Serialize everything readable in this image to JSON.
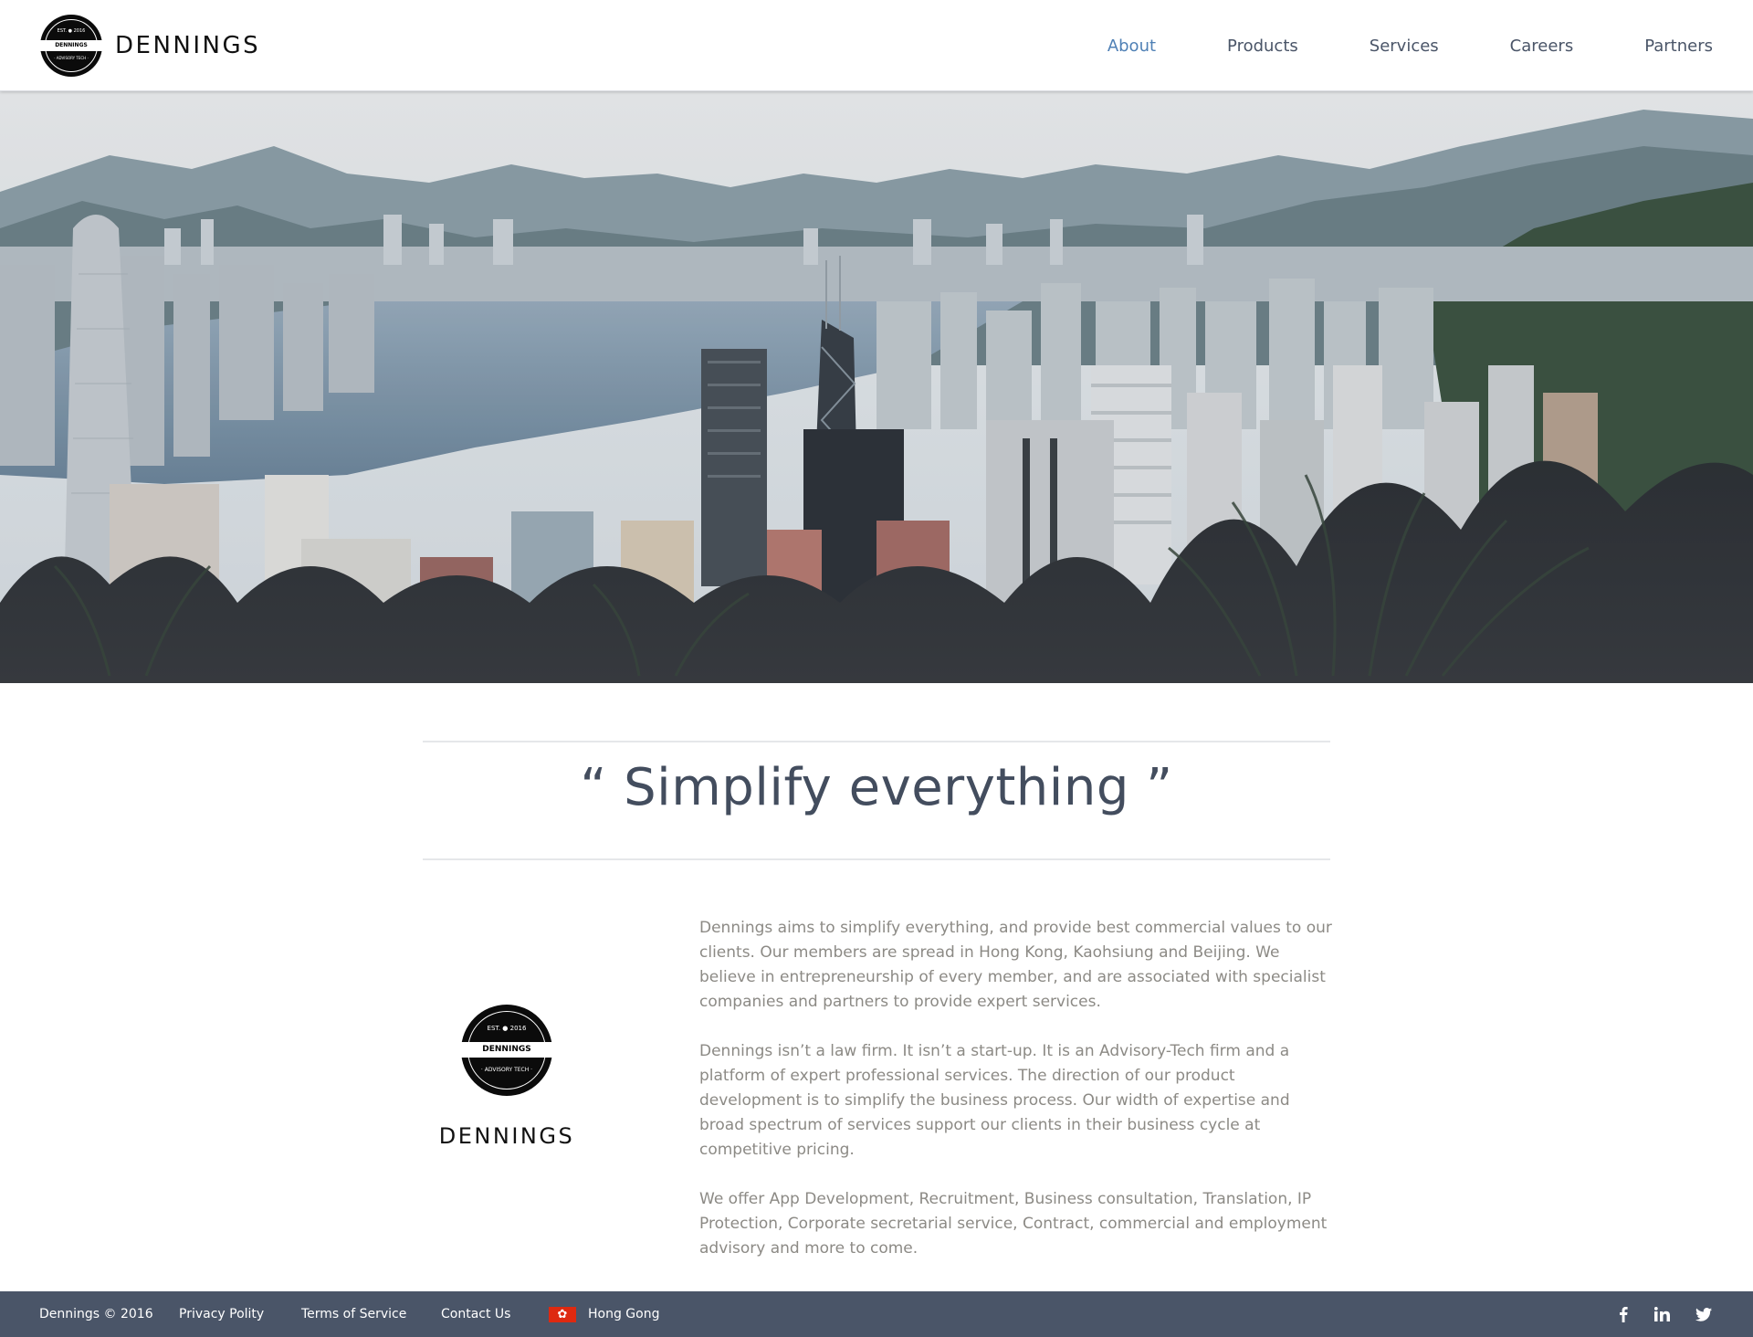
{
  "brand": {
    "name": "DENNINGS",
    "badge_est": "EST. ● 2016",
    "badge_name": "DENNINGS",
    "badge_sub": "· ADVISORY TECH ·"
  },
  "nav": {
    "items": [
      {
        "label": "About",
        "active": true
      },
      {
        "label": "Products",
        "active": false
      },
      {
        "label": "Services",
        "active": false
      },
      {
        "label": "Careers",
        "active": false
      },
      {
        "label": "Partners",
        "active": false
      }
    ]
  },
  "hero": {
    "image": "hong-kong-skyline-photo"
  },
  "quote": {
    "text": "“ Simplify everything ”"
  },
  "about": {
    "logo_name": "DENNINGS",
    "paragraphs": [
      "Dennings aims to simplify everything, and provide best commercial values to our clients. Our members are spread in Hong Kong, Kaohsiung and Beijing. We believe in entrepreneurship of every member, and are associated with specialist companies and partners to provide expert services.",
      "Dennings isn’t a law firm. It isn’t a start-up. It is an Advisory-Tech firm and a platform of expert professional services. The direction of our product development is to simplify the business process. Our width of expertise and broad spectrum of services support our clients in their business cycle at competitive pricing.",
      "We offer App Development, Recruitment, Business consultation, Translation, IP Protection, Corporate secretarial service, Contract, commercial and employment advisory and more to come."
    ]
  },
  "footer": {
    "copyright": "Dennings © 2016",
    "privacy": "Privacy Polity",
    "terms": "Terms of Service",
    "contact": "Contact Us",
    "region": "Hong Gong",
    "region_flag_icon": "hong-kong-flag-icon",
    "social_icons": [
      "facebook-icon",
      "linkedin-icon",
      "twitter-icon"
    ]
  },
  "colors": {
    "nav_active": "#4f80b5",
    "nav_text": "#4a5568",
    "quote_text": "#434d5e",
    "body_text": "#8c8a85",
    "footer_bg": "#4a5568"
  }
}
